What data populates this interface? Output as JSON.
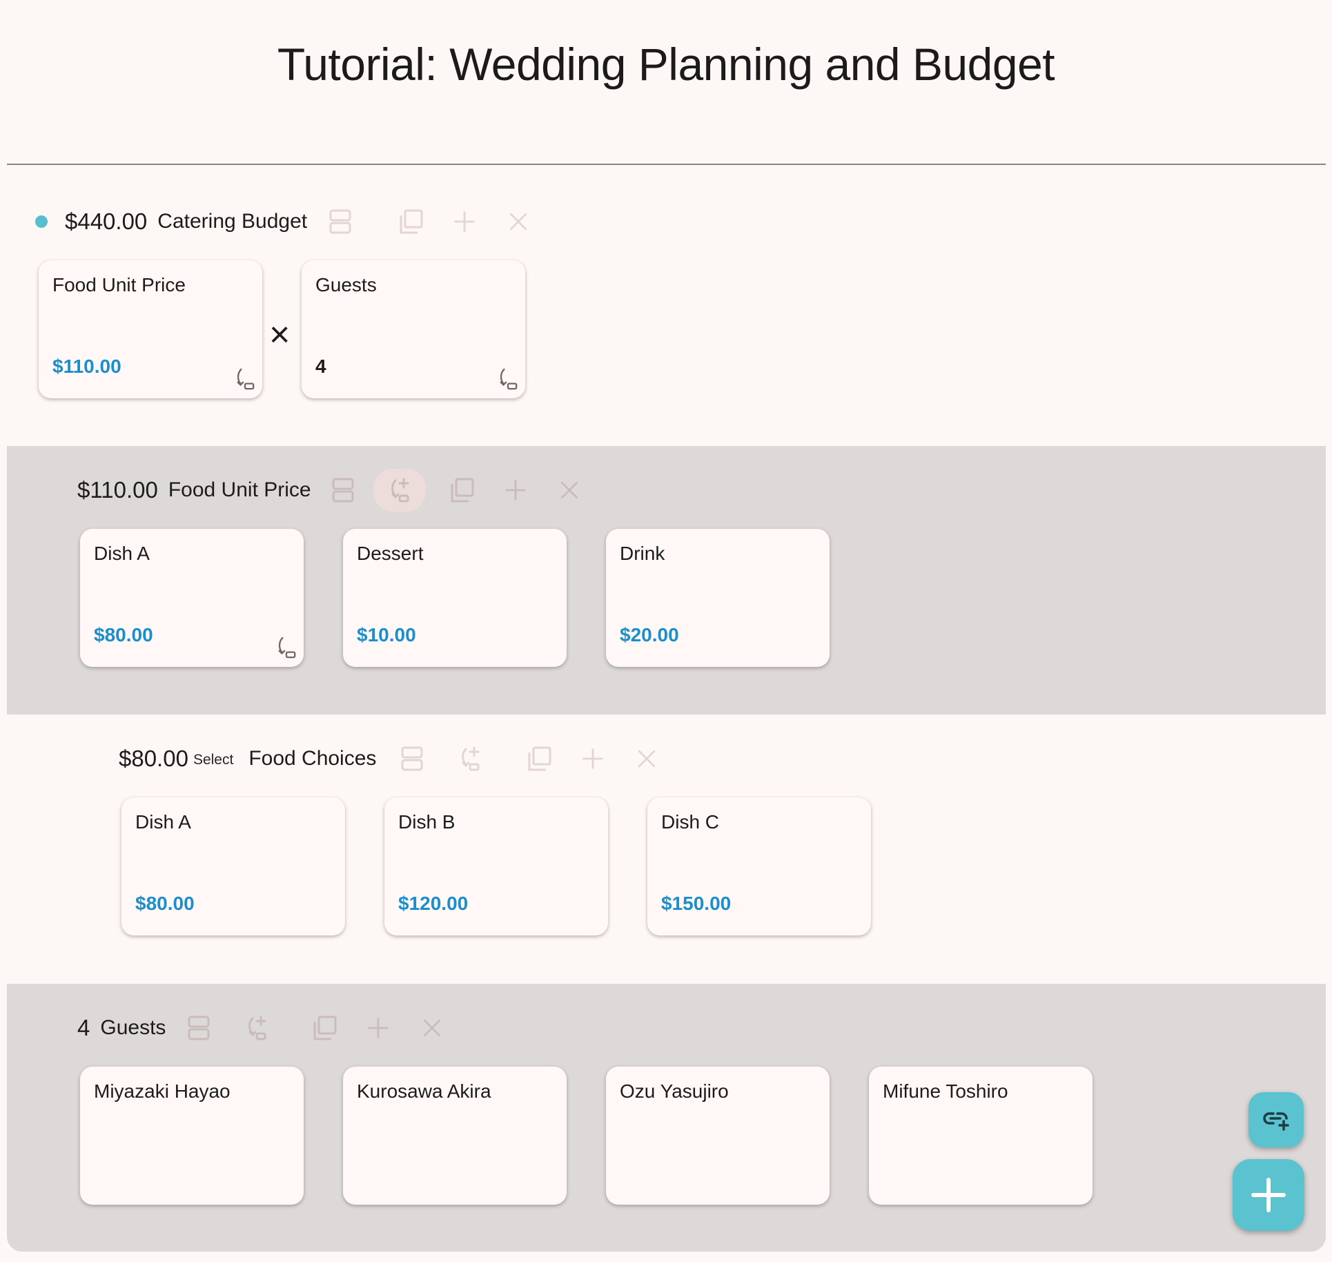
{
  "title": "Tutorial: Wedding Planning and Budget",
  "colors": {
    "accent": "#55bfcf",
    "value": "#1a8fcb",
    "band": "#ded9d9",
    "background": "#fdf7f5"
  },
  "rows": [
    {
      "amount": "$440.00",
      "label": "Catering Budget",
      "operator": "×",
      "cards": [
        {
          "name": "Food Unit Price",
          "value": "$110.00"
        },
        {
          "name": "Guests",
          "value": "4"
        }
      ]
    },
    {
      "amount": "$110.00",
      "label": "Food Unit Price",
      "cards": [
        {
          "name": "Dish A",
          "value": "$80.00"
        },
        {
          "name": "Dessert",
          "value": "$10.00"
        },
        {
          "name": "Drink",
          "value": "$20.00"
        }
      ]
    },
    {
      "amount": "$80.00",
      "tag": "Select",
      "label": "Food Choices",
      "cards": [
        {
          "name": "Dish A",
          "value": "$80.00"
        },
        {
          "name": "Dish B",
          "value": "$120.00"
        },
        {
          "name": "Dish C",
          "value": "$150.00"
        }
      ]
    },
    {
      "amount": "4",
      "label": "Guests",
      "cards": [
        {
          "name": "Miyazaki Hayao"
        },
        {
          "name": "Kurosawa Akira"
        },
        {
          "name": "Ozu Yasujiro"
        },
        {
          "name": "Mifune Toshiro"
        }
      ]
    }
  ],
  "icons": [
    "split-icon",
    "drill-add-icon",
    "duplicate-icon",
    "plus-icon",
    "close-icon",
    "link-add-icon",
    "drill-down-icon"
  ]
}
